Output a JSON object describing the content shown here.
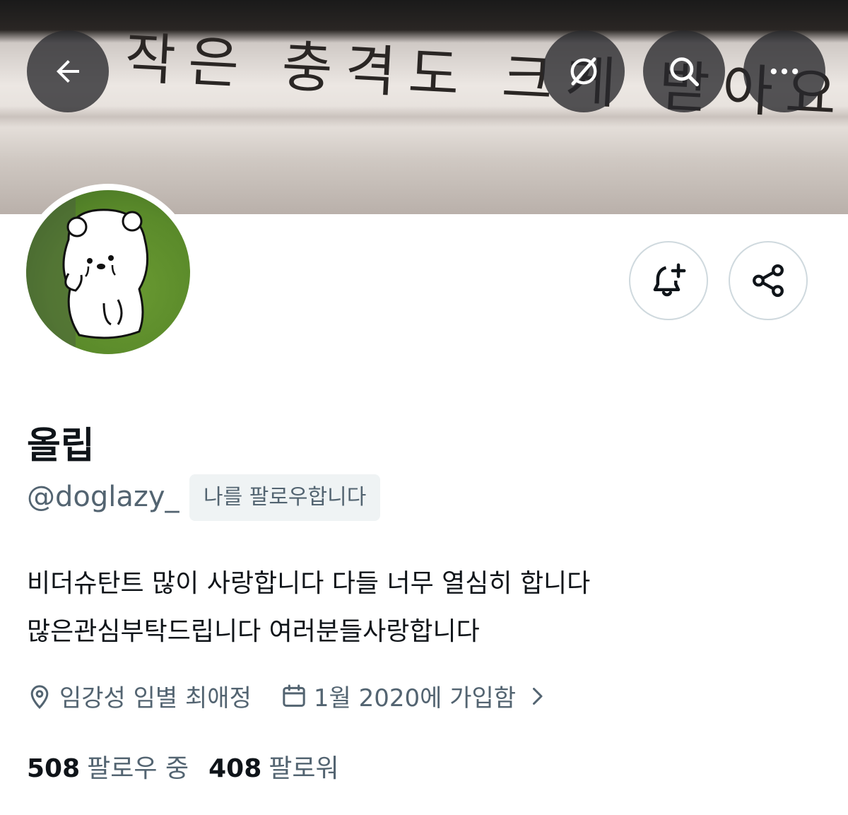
{
  "banner": {
    "handwriting": "작은 충격도 크게 받아요!"
  },
  "topbar": {
    "back_icon": "arrow-left-icon",
    "grok_icon": "grok-icon",
    "search_icon": "search-icon",
    "more_icon": "more-horizontal-icon"
  },
  "actions": {
    "notify_icon": "bell-plus-icon",
    "share_icon": "share-icon"
  },
  "profile": {
    "display_name": "올립",
    "handle": "@doglazy_",
    "follows_you": "나를 팔로우합니다",
    "bio_lines": [
      "비더슈탄트 많이 사랑합니다 다들 너무 열심히 합니다",
      "많은관심부탁드립니다 여러분들사랑합니다"
    ],
    "location": "임강성 임별 최애정",
    "joined": "1월 2020에 가입함",
    "following_count": "508",
    "following_label": "팔로우 중",
    "followers_count": "408",
    "followers_label": "팔로워"
  },
  "colors": {
    "text_primary": "#0f1419",
    "text_secondary": "#536471",
    "chip_bg": "#eff3f4",
    "button_border": "#cfd9de",
    "overlay_button": "#28282c"
  }
}
